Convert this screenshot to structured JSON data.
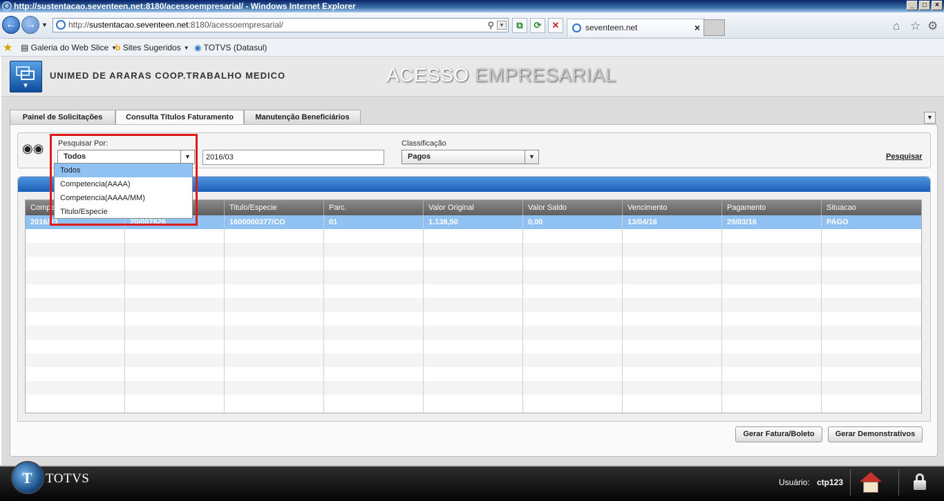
{
  "window": {
    "title": "http://sustentacao.seventeen.net:8180/acessoempresarial/ - Windows Internet Explorer"
  },
  "browser": {
    "address_prefix": "http://",
    "address_host": "sustentacao.seventeen.net",
    "address_path": ":8180/acessoempresarial/",
    "tab_title": "seventeen.net",
    "favorites": [
      "Galeria do Web Slice",
      "Sites Sugeridos",
      "TOTVS (Datasul)"
    ]
  },
  "header": {
    "company": "UNIMED DE ARARAS COOP.TRABALHO MEDICO",
    "title_part1": "ACESSO",
    "title_part2": "EMPRESARIAL"
  },
  "tabs": [
    {
      "label": "Painel de Solicitações"
    },
    {
      "label": "Consulta Títulos Faturamento"
    },
    {
      "label": "Manutenção Beneficiários"
    }
  ],
  "search": {
    "pesquisar_label": "Pesquisar Por:",
    "pesquisar_value": "Todos",
    "competencia_value": "2016/03",
    "classificacao_label": "Classificação",
    "classificacao_value": "Pagos",
    "pesquisar_link": "Pesquisar",
    "dropdown_options": [
      "Todos",
      "Competencia(AAAA)",
      "Competencia(AAAA/MM)",
      "Titulo/Especie"
    ]
  },
  "grid": {
    "columns": [
      "Compet",
      "",
      "Titulo/Especie",
      "Parc.",
      "Valor Original",
      "Valor Saldo",
      "Vencimento",
      "Pagamento",
      "Situacao"
    ],
    "rows": [
      [
        "2016/03",
        "20/007626",
        "1600000377/CO",
        "01",
        "1.138,50",
        "0,00",
        "13/04/16",
        "29/03/16",
        "PAGO"
      ]
    ]
  },
  "buttons": {
    "gerar_fatura": "Gerar Fatura/Boleto",
    "gerar_demonstrativos": "Gerar Demonstrativos"
  },
  "footer": {
    "brand": "TOTVS",
    "user_label": "Usuário:",
    "user_value": "ctp123"
  }
}
